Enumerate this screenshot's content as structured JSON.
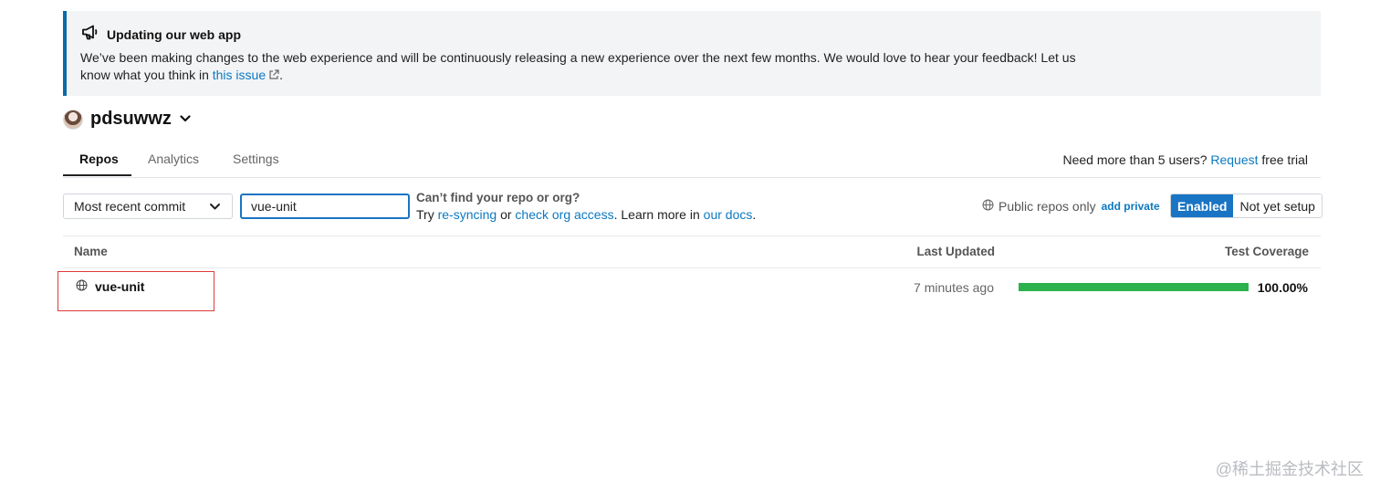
{
  "banner": {
    "title": "Updating our web app",
    "text_before": "We’ve been making changes to the web experience and will be continuously releasing a new experience over the next few months. We would love to hear your feedback! Let us know what you think in ",
    "link_text": "this issue",
    "text_after": "."
  },
  "org": {
    "name": "pdsuwwz"
  },
  "tabs": [
    {
      "label": "Repos"
    },
    {
      "label": "Analytics"
    },
    {
      "label": "Settings"
    }
  ],
  "users_note": {
    "text": "Need more than 5 users?",
    "link": "Request",
    "after": "free trial"
  },
  "toolbar": {
    "sort_selected": "Most recent commit",
    "search_value": "vue-unit",
    "hint_title": "Can’t find your repo or org?",
    "hint_try": "Try ",
    "hint_resync": "re-syncing",
    "hint_or": " or ",
    "hint_check": "check org access",
    "hint_learn": ". Learn more in ",
    "hint_docs": "our docs",
    "hint_end": ".",
    "visibility_label": "Public repos only",
    "add_private": "add private",
    "enabled_label": "Enabled",
    "not_setup_label": "Not yet setup"
  },
  "table": {
    "headers": {
      "name": "Name",
      "last_updated": "Last Updated",
      "coverage": "Test Coverage"
    },
    "rows": [
      {
        "name": "vue-unit",
        "last_updated": "7 minutes ago",
        "coverage_text": "100.00%",
        "coverage_fraction": 1.0
      }
    ]
  },
  "watermark": "@稀土掘金技术社区",
  "colors": {
    "accent": "#1a74c4",
    "link": "#0b79c2",
    "coverage_green": "#2bb24c",
    "highlight_red": "#e03b3b"
  }
}
